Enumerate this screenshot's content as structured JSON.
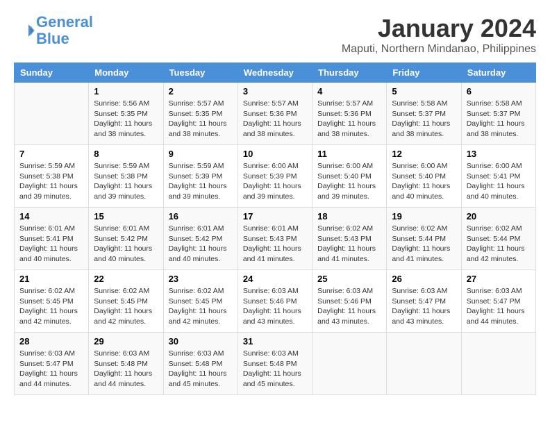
{
  "header": {
    "logo_line1": "General",
    "logo_line2": "Blue",
    "month_title": "January 2024",
    "location": "Maputi, Northern Mindanao, Philippines"
  },
  "weekdays": [
    "Sunday",
    "Monday",
    "Tuesday",
    "Wednesday",
    "Thursday",
    "Friday",
    "Saturday"
  ],
  "weeks": [
    [
      {
        "day": "",
        "info": ""
      },
      {
        "day": "1",
        "info": "Sunrise: 5:56 AM\nSunset: 5:35 PM\nDaylight: 11 hours\nand 38 minutes."
      },
      {
        "day": "2",
        "info": "Sunrise: 5:57 AM\nSunset: 5:35 PM\nDaylight: 11 hours\nand 38 minutes."
      },
      {
        "day": "3",
        "info": "Sunrise: 5:57 AM\nSunset: 5:36 PM\nDaylight: 11 hours\nand 38 minutes."
      },
      {
        "day": "4",
        "info": "Sunrise: 5:57 AM\nSunset: 5:36 PM\nDaylight: 11 hours\nand 38 minutes."
      },
      {
        "day": "5",
        "info": "Sunrise: 5:58 AM\nSunset: 5:37 PM\nDaylight: 11 hours\nand 38 minutes."
      },
      {
        "day": "6",
        "info": "Sunrise: 5:58 AM\nSunset: 5:37 PM\nDaylight: 11 hours\nand 38 minutes."
      }
    ],
    [
      {
        "day": "7",
        "info": "Sunrise: 5:59 AM\nSunset: 5:38 PM\nDaylight: 11 hours\nand 39 minutes."
      },
      {
        "day": "8",
        "info": "Sunrise: 5:59 AM\nSunset: 5:38 PM\nDaylight: 11 hours\nand 39 minutes."
      },
      {
        "day": "9",
        "info": "Sunrise: 5:59 AM\nSunset: 5:39 PM\nDaylight: 11 hours\nand 39 minutes."
      },
      {
        "day": "10",
        "info": "Sunrise: 6:00 AM\nSunset: 5:39 PM\nDaylight: 11 hours\nand 39 minutes."
      },
      {
        "day": "11",
        "info": "Sunrise: 6:00 AM\nSunset: 5:40 PM\nDaylight: 11 hours\nand 39 minutes."
      },
      {
        "day": "12",
        "info": "Sunrise: 6:00 AM\nSunset: 5:40 PM\nDaylight: 11 hours\nand 40 minutes."
      },
      {
        "day": "13",
        "info": "Sunrise: 6:00 AM\nSunset: 5:41 PM\nDaylight: 11 hours\nand 40 minutes."
      }
    ],
    [
      {
        "day": "14",
        "info": "Sunrise: 6:01 AM\nSunset: 5:41 PM\nDaylight: 11 hours\nand 40 minutes."
      },
      {
        "day": "15",
        "info": "Sunrise: 6:01 AM\nSunset: 5:42 PM\nDaylight: 11 hours\nand 40 minutes."
      },
      {
        "day": "16",
        "info": "Sunrise: 6:01 AM\nSunset: 5:42 PM\nDaylight: 11 hours\nand 40 minutes."
      },
      {
        "day": "17",
        "info": "Sunrise: 6:01 AM\nSunset: 5:43 PM\nDaylight: 11 hours\nand 41 minutes."
      },
      {
        "day": "18",
        "info": "Sunrise: 6:02 AM\nSunset: 5:43 PM\nDaylight: 11 hours\nand 41 minutes."
      },
      {
        "day": "19",
        "info": "Sunrise: 6:02 AM\nSunset: 5:44 PM\nDaylight: 11 hours\nand 41 minutes."
      },
      {
        "day": "20",
        "info": "Sunrise: 6:02 AM\nSunset: 5:44 PM\nDaylight: 11 hours\nand 42 minutes."
      }
    ],
    [
      {
        "day": "21",
        "info": "Sunrise: 6:02 AM\nSunset: 5:45 PM\nDaylight: 11 hours\nand 42 minutes."
      },
      {
        "day": "22",
        "info": "Sunrise: 6:02 AM\nSunset: 5:45 PM\nDaylight: 11 hours\nand 42 minutes."
      },
      {
        "day": "23",
        "info": "Sunrise: 6:02 AM\nSunset: 5:45 PM\nDaylight: 11 hours\nand 42 minutes."
      },
      {
        "day": "24",
        "info": "Sunrise: 6:03 AM\nSunset: 5:46 PM\nDaylight: 11 hours\nand 43 minutes."
      },
      {
        "day": "25",
        "info": "Sunrise: 6:03 AM\nSunset: 5:46 PM\nDaylight: 11 hours\nand 43 minutes."
      },
      {
        "day": "26",
        "info": "Sunrise: 6:03 AM\nSunset: 5:47 PM\nDaylight: 11 hours\nand 43 minutes."
      },
      {
        "day": "27",
        "info": "Sunrise: 6:03 AM\nSunset: 5:47 PM\nDaylight: 11 hours\nand 44 minutes."
      }
    ],
    [
      {
        "day": "28",
        "info": "Sunrise: 6:03 AM\nSunset: 5:47 PM\nDaylight: 11 hours\nand 44 minutes."
      },
      {
        "day": "29",
        "info": "Sunrise: 6:03 AM\nSunset: 5:48 PM\nDaylight: 11 hours\nand 44 minutes."
      },
      {
        "day": "30",
        "info": "Sunrise: 6:03 AM\nSunset: 5:48 PM\nDaylight: 11 hours\nand 45 minutes."
      },
      {
        "day": "31",
        "info": "Sunrise: 6:03 AM\nSunset: 5:48 PM\nDaylight: 11 hours\nand 45 minutes."
      },
      {
        "day": "",
        "info": ""
      },
      {
        "day": "",
        "info": ""
      },
      {
        "day": "",
        "info": ""
      }
    ]
  ]
}
